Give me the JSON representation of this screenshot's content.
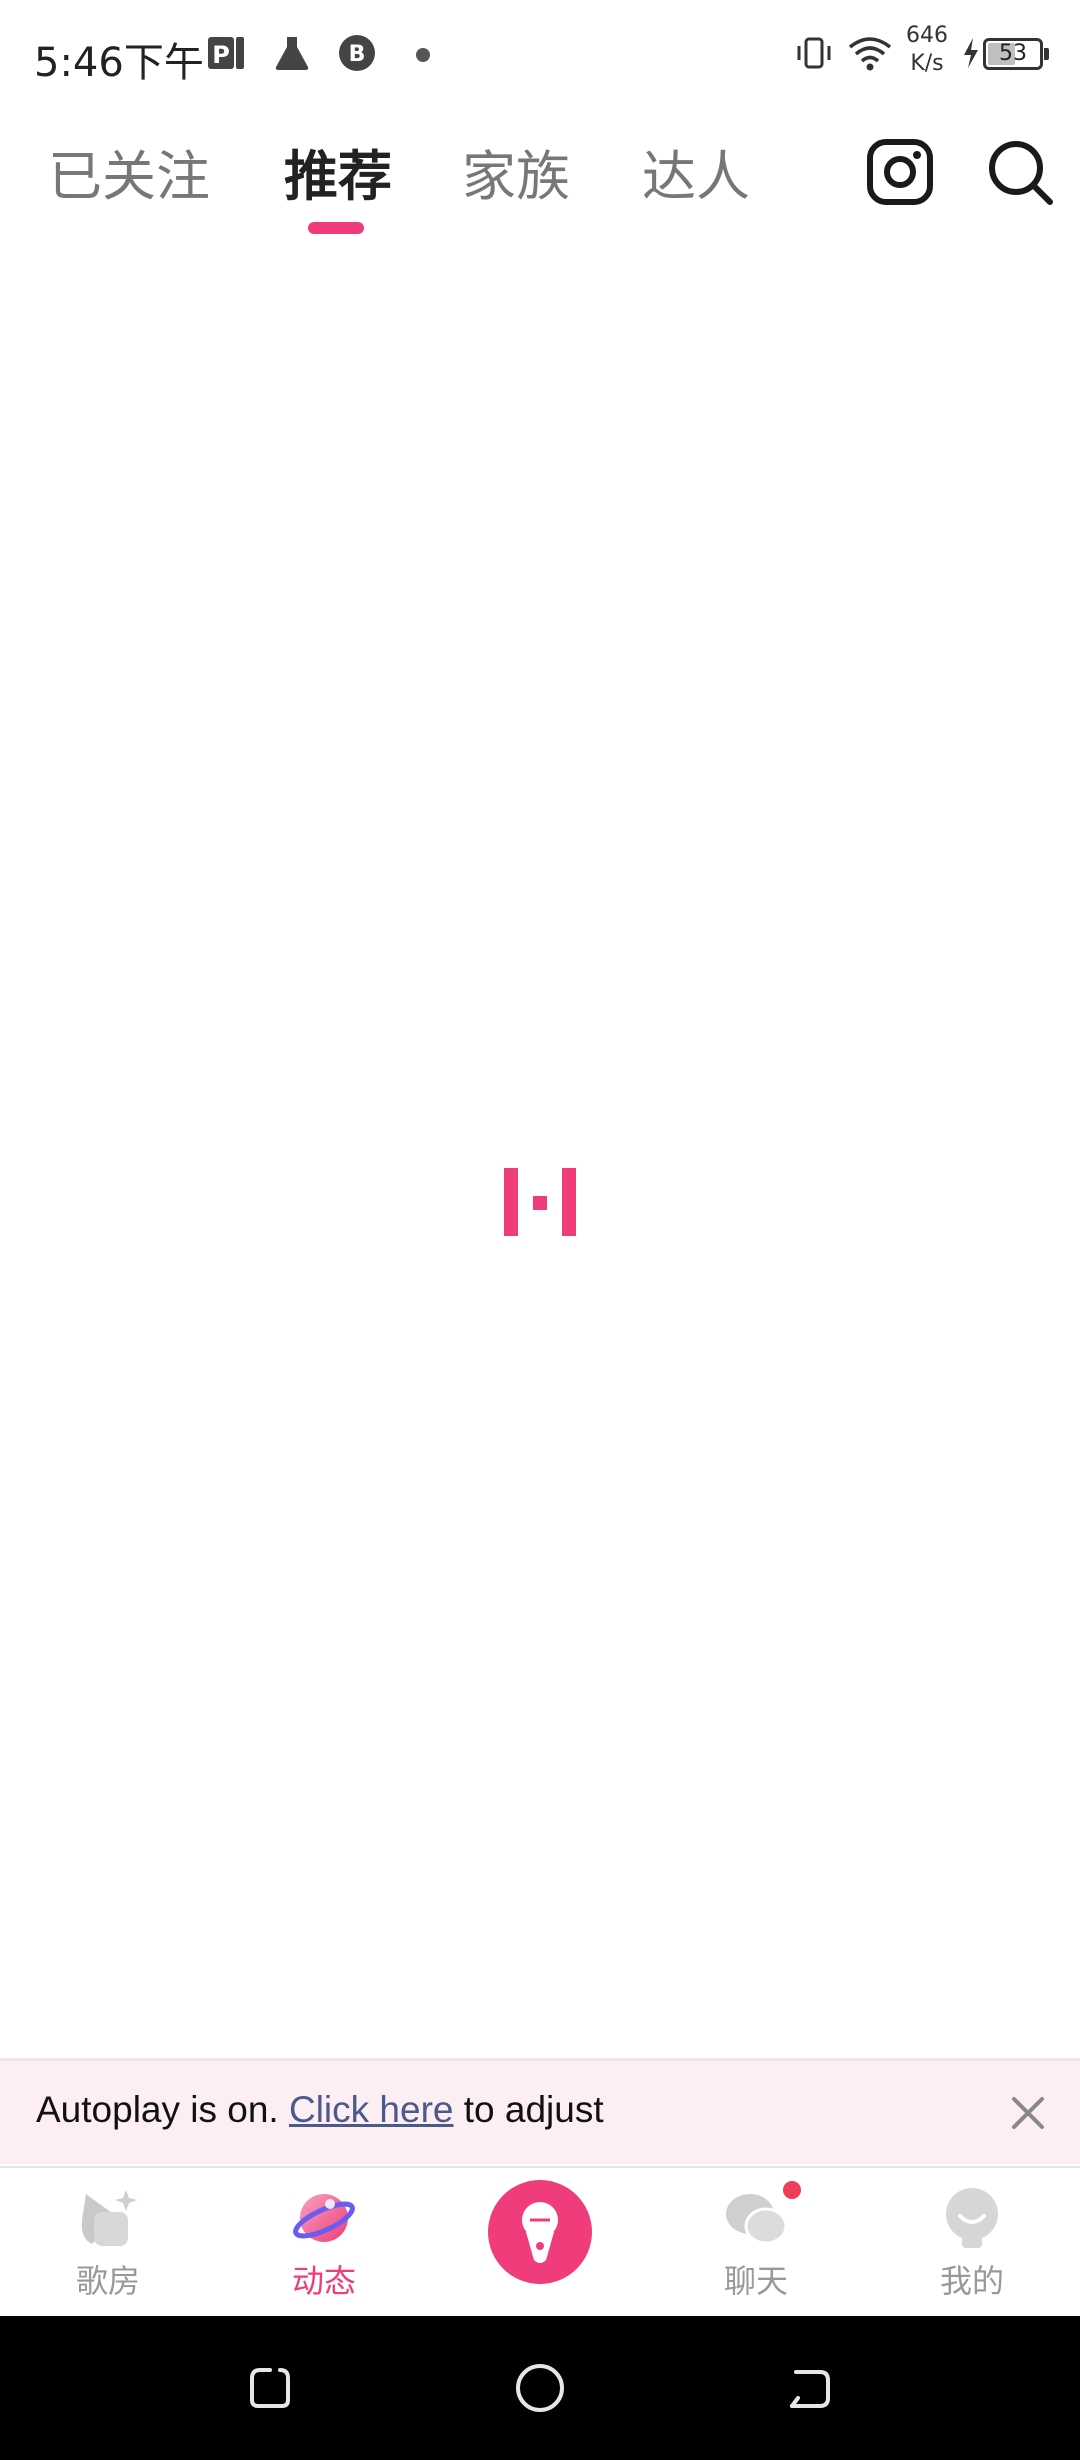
{
  "status_bar": {
    "time": "5:46下午",
    "net_speed_value": "646",
    "net_speed_unit": "K/s",
    "battery_level": "53",
    "battery_fraction": 0.53,
    "icons": [
      "parking-app-icon",
      "flask-icon",
      "b-badge-icon",
      "dot-indicator",
      "vibrate-icon",
      "wifi-icon",
      "charging-icon",
      "battery-icon"
    ]
  },
  "top_nav": {
    "tabs": [
      {
        "label": "已关注",
        "active": false
      },
      {
        "label": "推荐",
        "active": true
      },
      {
        "label": "家族",
        "active": false
      },
      {
        "label": "达人",
        "active": false
      }
    ],
    "accent_color": "#f03c7a",
    "icons": [
      "instagram-icon",
      "search-icon"
    ]
  },
  "banner": {
    "prefix": "Autoplay is on. ",
    "link": "Click here",
    "suffix": " to adjust",
    "background": "#fdeef4"
  },
  "bottom_nav": {
    "items": [
      {
        "label": "歌房",
        "icon": "song-room-icon",
        "active": false
      },
      {
        "label": "动态",
        "icon": "planet-icon",
        "active": true
      },
      {
        "label": "",
        "icon": "microphone-icon",
        "active": false
      },
      {
        "label": "聊天",
        "icon": "chat-bubbles-icon",
        "active": false,
        "badge": true
      },
      {
        "label": "我的",
        "icon": "profile-icon",
        "active": false
      }
    ]
  },
  "system_nav": {
    "icons": [
      "recent-apps-icon",
      "home-icon",
      "back-icon"
    ]
  }
}
